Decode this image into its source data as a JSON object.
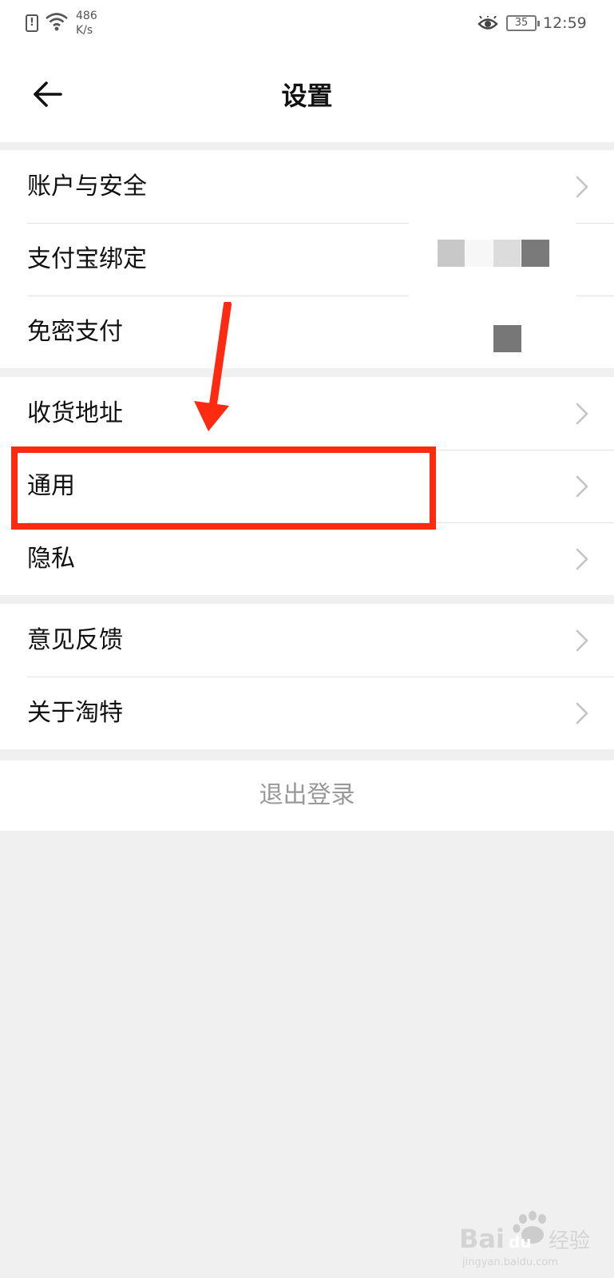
{
  "status_bar": {
    "sim_alert": "!",
    "net_speed_value": "486",
    "net_speed_unit": "K/s",
    "battery_level": "35",
    "time": "12:59"
  },
  "header": {
    "title": "设置"
  },
  "groups": [
    {
      "rows": [
        {
          "label": "账户与安全",
          "chevron": true
        },
        {
          "label": "支付宝绑定",
          "chevron": false
        },
        {
          "label": "免密支付",
          "chevron": false
        }
      ]
    },
    {
      "rows": [
        {
          "label": "收货地址",
          "chevron": true
        },
        {
          "label": "通用",
          "chevron": true
        },
        {
          "label": "隐私",
          "chevron": true
        }
      ]
    },
    {
      "rows": [
        {
          "label": "意见反馈",
          "chevron": true
        },
        {
          "label": "关于淘特",
          "chevron": true
        }
      ]
    }
  ],
  "logout": {
    "label": "退出登录"
  },
  "annotation": {
    "highlight_color": "#ff2a12",
    "highlighted_row": "通用"
  },
  "colors": {
    "background": "#f0f0f0",
    "surface": "#ffffff",
    "text_primary": "#111111",
    "text_muted": "#999999",
    "chevron": "#c4c4c4",
    "divider": "#e2e2e2"
  },
  "watermark": {
    "brand": "Baidu",
    "text": "经验",
    "url": "jingyan.baidu.com"
  }
}
